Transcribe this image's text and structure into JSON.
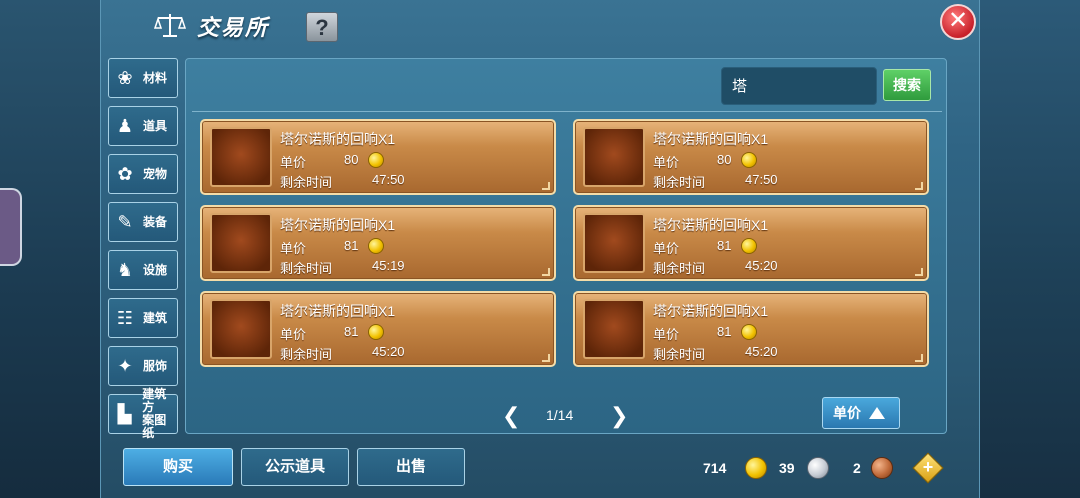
{
  "window": {
    "title": "交易所",
    "help_label": "?",
    "close_label": "✕"
  },
  "sidebar": {
    "items": [
      {
        "label": "材料",
        "icon": "materials-icon",
        "glyph": "❀"
      },
      {
        "label": "道具",
        "icon": "item-icon",
        "glyph": "♟"
      },
      {
        "label": "宠物",
        "icon": "paw-icon",
        "glyph": "✿"
      },
      {
        "label": "装备",
        "icon": "equipment-icon",
        "glyph": "✎"
      },
      {
        "label": "设施",
        "icon": "facility-icon",
        "glyph": "♞"
      },
      {
        "label": "建筑",
        "icon": "building-icon",
        "glyph": "☷"
      },
      {
        "label": "服饰",
        "icon": "clothing-icon",
        "glyph": "✦"
      },
      {
        "label": "建筑方案图纸",
        "line1": "建筑方",
        "line2": "案图纸",
        "icon": "blueprint-icon",
        "glyph": "▙"
      }
    ]
  },
  "search": {
    "value": "塔",
    "button_label": "搜索"
  },
  "listings": [
    {
      "name": "塔尔诺斯的回响X1",
      "price_label": "单价",
      "price": "80",
      "time_label": "剩余时间",
      "time": "47:50"
    },
    {
      "name": "塔尔诺斯的回响X1",
      "price_label": "单价",
      "price": "80",
      "time_label": "剩余时间",
      "time": "47:50"
    },
    {
      "name": "塔尔诺斯的回响X1",
      "price_label": "单价",
      "price": "81",
      "time_label": "剩余时间",
      "time": "45:19"
    },
    {
      "name": "塔尔诺斯的回响X1",
      "price_label": "单价",
      "price": "81",
      "time_label": "剩余时间",
      "time": "45:20"
    },
    {
      "name": "塔尔诺斯的回响X1",
      "price_label": "单价",
      "price": "81",
      "time_label": "剩余时间",
      "time": "45:20"
    },
    {
      "name": "塔尔诺斯的回响X1",
      "price_label": "单价",
      "price": "81",
      "time_label": "剩余时间",
      "time": "45:20"
    }
  ],
  "pager": {
    "text": "1/14",
    "prev": "❮",
    "next": "❯"
  },
  "sort": {
    "label": "单价"
  },
  "tabs": {
    "buy": "购买",
    "public": "公示道具",
    "sell": "出售"
  },
  "currency": {
    "gold": "714",
    "silver": "39",
    "copper": "2",
    "add": "+"
  }
}
